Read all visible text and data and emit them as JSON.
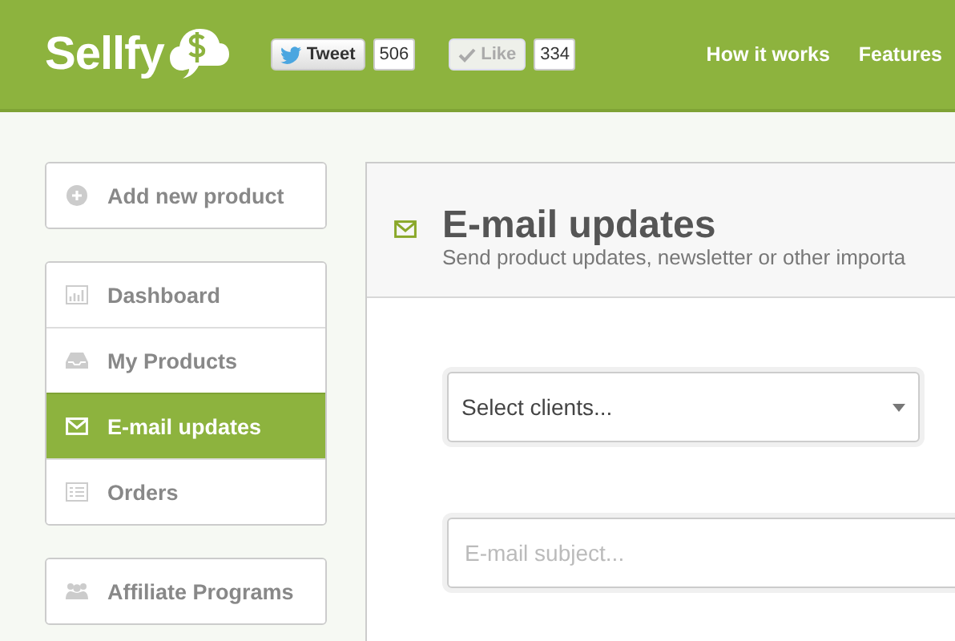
{
  "header": {
    "logo": "Sellfy",
    "social": [
      {
        "kind": "tweet",
        "label": "Tweet",
        "count": "506"
      },
      {
        "kind": "like",
        "label": "Like",
        "count": "334"
      }
    ],
    "nav": [
      "How it works",
      "Features"
    ]
  },
  "sidebar": {
    "groups": [
      [
        {
          "kind": "plus",
          "label": "Add new product",
          "selected": false
        }
      ],
      [
        {
          "kind": "chart",
          "label": "Dashboard",
          "selected": false
        },
        {
          "kind": "inbox",
          "label": "My Products",
          "selected": false
        },
        {
          "kind": "mail",
          "label": "E-mail updates",
          "selected": true
        },
        {
          "kind": "list",
          "label": "Orders",
          "selected": false
        }
      ],
      [
        {
          "kind": "people",
          "label": "Affiliate Programs",
          "selected": false
        }
      ]
    ]
  },
  "panel": {
    "title": "E-mail updates",
    "subtitle": "Send product updates, newsletter or other importa",
    "select": {
      "value": "Select clients..."
    },
    "subject": {
      "placeholder": "E-mail subject..."
    }
  }
}
